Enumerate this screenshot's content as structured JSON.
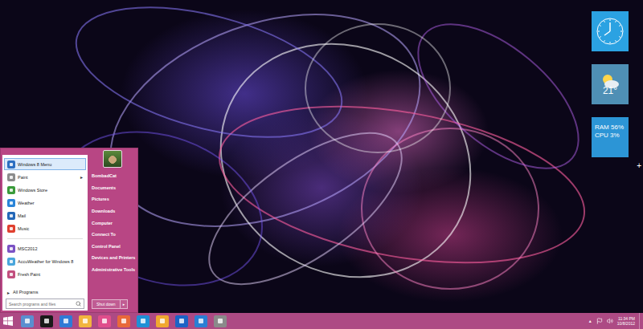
{
  "start_menu": {
    "pinned": [
      {
        "label": "Windows 8 Menu",
        "selected": true,
        "submenu": false,
        "color": "#2c6fc1"
      },
      {
        "label": "Paint",
        "selected": false,
        "submenu": true,
        "color": "#8c8c8c"
      },
      {
        "label": "Windows Store",
        "selected": false,
        "submenu": false,
        "color": "#3a9b3a"
      },
      {
        "label": "Weather",
        "selected": false,
        "submenu": false,
        "color": "#2a84d8"
      },
      {
        "label": "Mail",
        "selected": false,
        "submenu": false,
        "color": "#2468b8"
      },
      {
        "label": "Music",
        "selected": false,
        "submenu": false,
        "color": "#e0402f"
      }
    ],
    "recent": [
      {
        "label": "MSC2012",
        "selected": false,
        "submenu": false,
        "color": "#7b52c4"
      },
      {
        "label": "AccuWeather for Windows 8",
        "selected": false,
        "submenu": false,
        "color": "#4aa6dc"
      },
      {
        "label": "Fresh Paint",
        "selected": false,
        "submenu": false,
        "color": "#c24f7e"
      }
    ],
    "submenu_arrow": "▸",
    "all_programs": {
      "label": "All Programs",
      "arrow": "▸"
    },
    "search": {
      "placeholder": "Search programs and files"
    },
    "user": {
      "name": "BombadCat"
    },
    "places": [
      "Documents",
      "Pictures",
      "Downloads",
      "Computer",
      "Connect To",
      "Control Panel",
      "Devices and Printers",
      "Administrative Tools"
    ],
    "shutdown": {
      "label": "Shut down",
      "arrow": "▸"
    }
  },
  "gadgets": {
    "weather": {
      "temperature": "21°"
    },
    "meter": {
      "ram": "RAM 56%",
      "cpu": "CPU 3%"
    },
    "add": "+"
  },
  "taskbar": {
    "apps": [
      {
        "color": "#5a8fd0"
      },
      {
        "color": "#1a1a1a"
      },
      {
        "color": "#2f7ad6"
      },
      {
        "color": "#f2b53e"
      },
      {
        "color": "#e04e8c"
      },
      {
        "color": "#e8693a"
      },
      {
        "color": "#1e90d6"
      },
      {
        "color": "#f0a830"
      },
      {
        "color": "#1b63c6"
      },
      {
        "color": "#2a7fd4"
      },
      {
        "color": "#8a8a8a"
      }
    ],
    "tray_arrow": "▲",
    "clock": {
      "time": "11:34 PM",
      "date": "10/8/2012"
    }
  }
}
